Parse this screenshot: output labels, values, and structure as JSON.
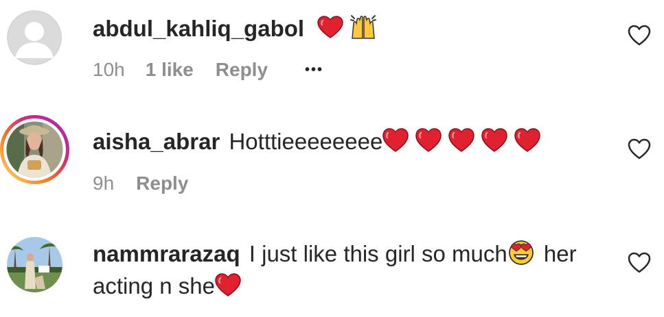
{
  "comments": [
    {
      "username": "abdul_kahliq_gabol",
      "text": "",
      "time": "10h",
      "likes": "1 like",
      "reply": "Reply",
      "more": "•••",
      "avatar": "default-avatar-icon"
    },
    {
      "username": "aisha_abrar",
      "text": "Hotttieeeeeeee",
      "time": "9h",
      "reply": "Reply",
      "avatar": "profile-photo-with-story-ring"
    },
    {
      "username": "nammrarazaq",
      "text_line1": "I just like this girl so much",
      "text_line1_after": " her",
      "text_line2": "acting n she",
      "avatar": "profile-photo"
    }
  ],
  "colors": {
    "username": "#262626",
    "meta": "#8e8e8e",
    "heart_emoji": "#e0212f",
    "default_avatar": "#dbdbdb"
  }
}
